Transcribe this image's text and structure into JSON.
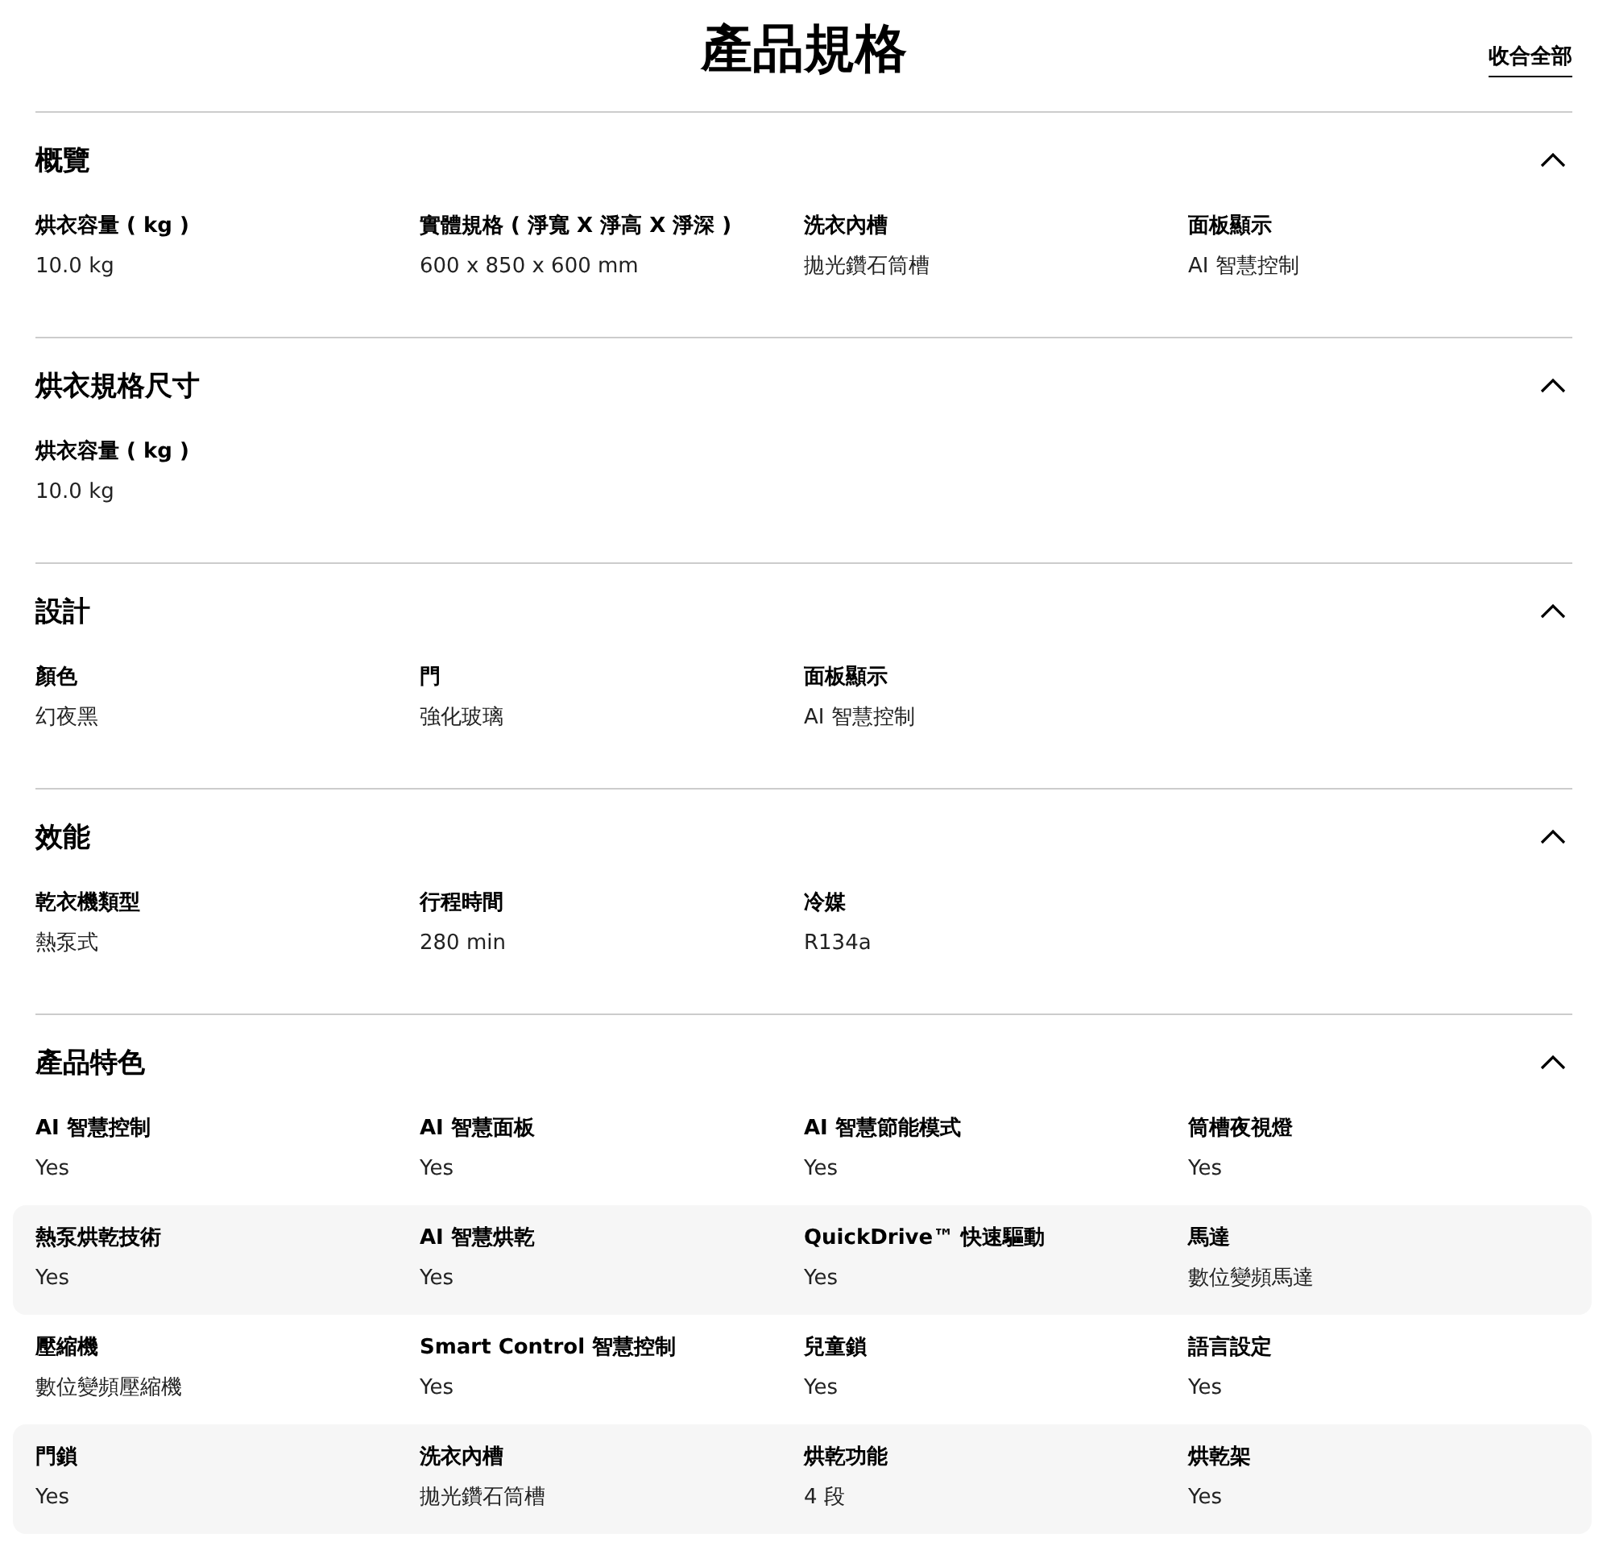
{
  "title": "產品規格",
  "collapse_all": "收合全部",
  "sections": [
    {
      "title": "概覽",
      "expanded": true,
      "rows": [
        [
          {
            "label": "烘衣容量 ( kg )",
            "value": "10.0 kg"
          },
          {
            "label": "實體規格 ( 淨寬 X 淨高 X 淨深 )",
            "value": "600 x 850 x 600 mm"
          },
          {
            "label": "洗衣內槽",
            "value": "拋光鑽石筒槽"
          },
          {
            "label": "面板顯示",
            "value": "AI 智慧控制"
          }
        ]
      ]
    },
    {
      "title": "烘衣規格尺寸",
      "expanded": true,
      "rows": [
        [
          {
            "label": "烘衣容量 ( kg )",
            "value": "10.0 kg"
          }
        ]
      ]
    },
    {
      "title": "設計",
      "expanded": true,
      "rows": [
        [
          {
            "label": "顏色",
            "value": "幻夜黑"
          },
          {
            "label": "門",
            "value": "強化玻璃"
          },
          {
            "label": "面板顯示",
            "value": "AI 智慧控制"
          }
        ]
      ]
    },
    {
      "title": "效能",
      "expanded": true,
      "rows": [
        [
          {
            "label": "乾衣機類型",
            "value": "熱泵式"
          },
          {
            "label": "行程時間",
            "value": "280 min"
          },
          {
            "label": "冷媒",
            "value": "R134a"
          }
        ]
      ]
    },
    {
      "title": "產品特色",
      "expanded": true,
      "rows": [
        [
          {
            "label": "AI 智慧控制",
            "value": "Yes"
          },
          {
            "label": "AI 智慧面板",
            "value": "Yes"
          },
          {
            "label": "AI 智慧節能模式",
            "value": "Yes"
          },
          {
            "label": "筒槽夜視燈",
            "value": "Yes"
          }
        ],
        [
          {
            "label": "熱泵烘乾技術",
            "value": "Yes"
          },
          {
            "label": "AI 智慧烘乾",
            "value": "Yes"
          },
          {
            "label": "QuickDrive™ 快速驅動",
            "value": "Yes"
          },
          {
            "label": "馬達",
            "value": "數位變頻馬達"
          }
        ],
        [
          {
            "label": "壓縮機",
            "value": "數位變頻壓縮機"
          },
          {
            "label": "Smart Control 智慧控制",
            "value": "Yes"
          },
          {
            "label": "兒童鎖",
            "value": "Yes"
          },
          {
            "label": "語言設定",
            "value": "Yes"
          }
        ],
        [
          {
            "label": "門鎖",
            "value": "Yes"
          },
          {
            "label": "洗衣內槽",
            "value": "拋光鑽石筒槽"
          },
          {
            "label": "烘乾功能",
            "value": "4 段"
          },
          {
            "label": "烘乾架",
            "value": "Yes"
          }
        ]
      ]
    }
  ]
}
